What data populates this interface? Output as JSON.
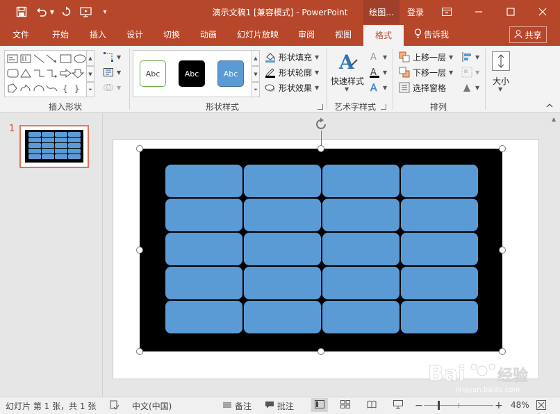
{
  "titlebar": {
    "doc_title": "演示文稿1 [兼容模式] - PowerPoint",
    "context_tab": "绘图...",
    "login": "登录"
  },
  "tabs": [
    "文件",
    "开始",
    "插入",
    "设计",
    "切换",
    "动画",
    "幻灯片放映",
    "审阅",
    "视图",
    "格式"
  ],
  "active_tab": "格式",
  "tell_me": "告诉我",
  "share": "共享",
  "ribbon": {
    "insert_shapes": {
      "label": "插入形状"
    },
    "shape_styles": {
      "label": "形状样式",
      "thumbs": [
        "Abc",
        "Abc",
        "Abc"
      ],
      "fill": "形状填充",
      "outline": "形状轮廓",
      "effects": "形状效果"
    },
    "wordart": {
      "label": "艺术字样式",
      "quick_styles": "快速样式"
    },
    "arrange": {
      "label": "排列",
      "bring_forward": "上移一层",
      "send_backward": "下移一层",
      "selection_pane": "选择窗格"
    },
    "size": {
      "label": "大小"
    }
  },
  "thumbnail": {
    "slide_number": "1"
  },
  "statusbar": {
    "slide_info": "幻灯片 第 1 张，共 1 张",
    "language": "中文(中国)",
    "notes": "备注",
    "comments": "批注",
    "zoom": "48%"
  },
  "colors": {
    "accent": "#b7472a",
    "cell_fill": "#5b9bd5",
    "rect_fill": "#000000"
  }
}
